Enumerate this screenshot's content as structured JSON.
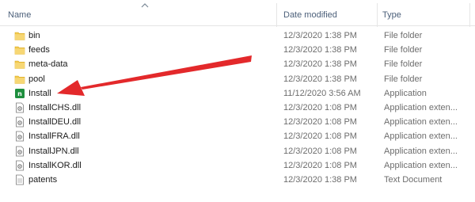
{
  "columns": {
    "name": "Name",
    "date": "Date modified",
    "type": "Type"
  },
  "accent": {
    "folder": "#f2c94c",
    "app_icon": "#1e8f3e",
    "arrow": "#e3292b"
  },
  "rows": [
    {
      "name": "bin",
      "date": "12/3/2020 1:38 PM",
      "type": "File folder",
      "icon": "folder-icon"
    },
    {
      "name": "feeds",
      "date": "12/3/2020 1:38 PM",
      "type": "File folder",
      "icon": "folder-icon"
    },
    {
      "name": "meta-data",
      "date": "12/3/2020 1:38 PM",
      "type": "File folder",
      "icon": "folder-icon"
    },
    {
      "name": "pool",
      "date": "12/3/2020 1:38 PM",
      "type": "File folder",
      "icon": "folder-icon"
    },
    {
      "name": "Install",
      "date": "11/12/2020 3:56 AM",
      "type": "Application",
      "icon": "application-icon"
    },
    {
      "name": "InstallCHS.dll",
      "date": "12/3/2020 1:08 PM",
      "type": "Application exten...",
      "icon": "dll-file-icon"
    },
    {
      "name": "InstallDEU.dll",
      "date": "12/3/2020 1:08 PM",
      "type": "Application exten...",
      "icon": "dll-file-icon"
    },
    {
      "name": "InstallFRA.dll",
      "date": "12/3/2020 1:08 PM",
      "type": "Application exten...",
      "icon": "dll-file-icon"
    },
    {
      "name": "InstallJPN.dll",
      "date": "12/3/2020 1:08 PM",
      "type": "Application exten...",
      "icon": "dll-file-icon"
    },
    {
      "name": "InstallKOR.dll",
      "date": "12/3/2020 1:08 PM",
      "type": "Application exten...",
      "icon": "dll-file-icon"
    },
    {
      "name": "patents",
      "date": "12/3/2020 1:38 PM",
      "type": "Text Document",
      "icon": "text-file-icon"
    }
  ]
}
